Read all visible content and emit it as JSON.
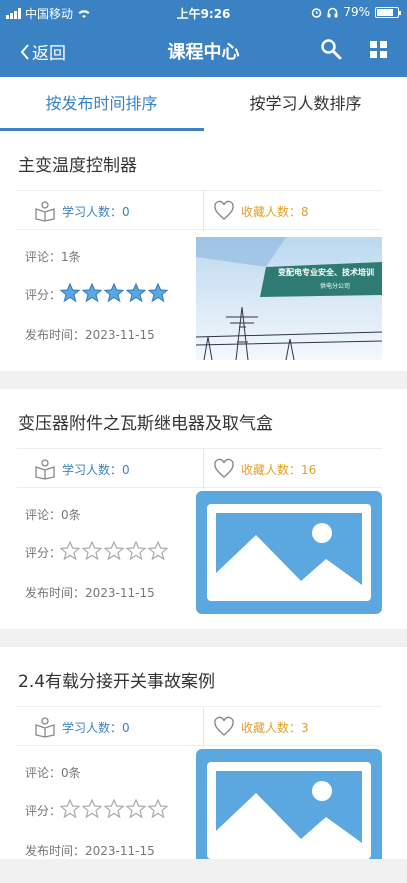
{
  "status_bar": {
    "carrier": "中国移动",
    "time": "上午9:26",
    "battery": "79%"
  },
  "nav": {
    "back_label": "返回",
    "title": "课程中心"
  },
  "tabs": [
    {
      "label": "按发布时间排序",
      "active": true
    },
    {
      "label": "按学习人数排序",
      "active": false
    }
  ],
  "courses": [
    {
      "title": "主变温度控制器",
      "study_label": "学习人数：0",
      "fav_label": "收藏人数：8",
      "comments": "评论：1条",
      "rating_label": "评分：",
      "rating": 5,
      "date": "发布时间：2023-11-15",
      "thumb_title": "变配电专业安全、技术培训",
      "thumb_subtitle": "供电分公司"
    },
    {
      "title": "变压器附件之瓦斯继电器及取气盒",
      "study_label": "学习人数：0",
      "fav_label": "收藏人数：16",
      "comments": "评论：0条",
      "rating_label": "评分：",
      "rating": 0,
      "date": "发布时间：2023-11-15"
    },
    {
      "title": "2.4有载分接开关事故案例",
      "study_label": "学习人数：0",
      "fav_label": "收藏人数：3",
      "comments": "评论：0条",
      "rating_label": "评分：",
      "rating": 0,
      "date": "发布时间：2023-11-15"
    }
  ],
  "colors": {
    "header": "#3a82c4",
    "study": "#3a82c4",
    "favorite": "#e0a02c",
    "star": "#5ba8e0"
  }
}
